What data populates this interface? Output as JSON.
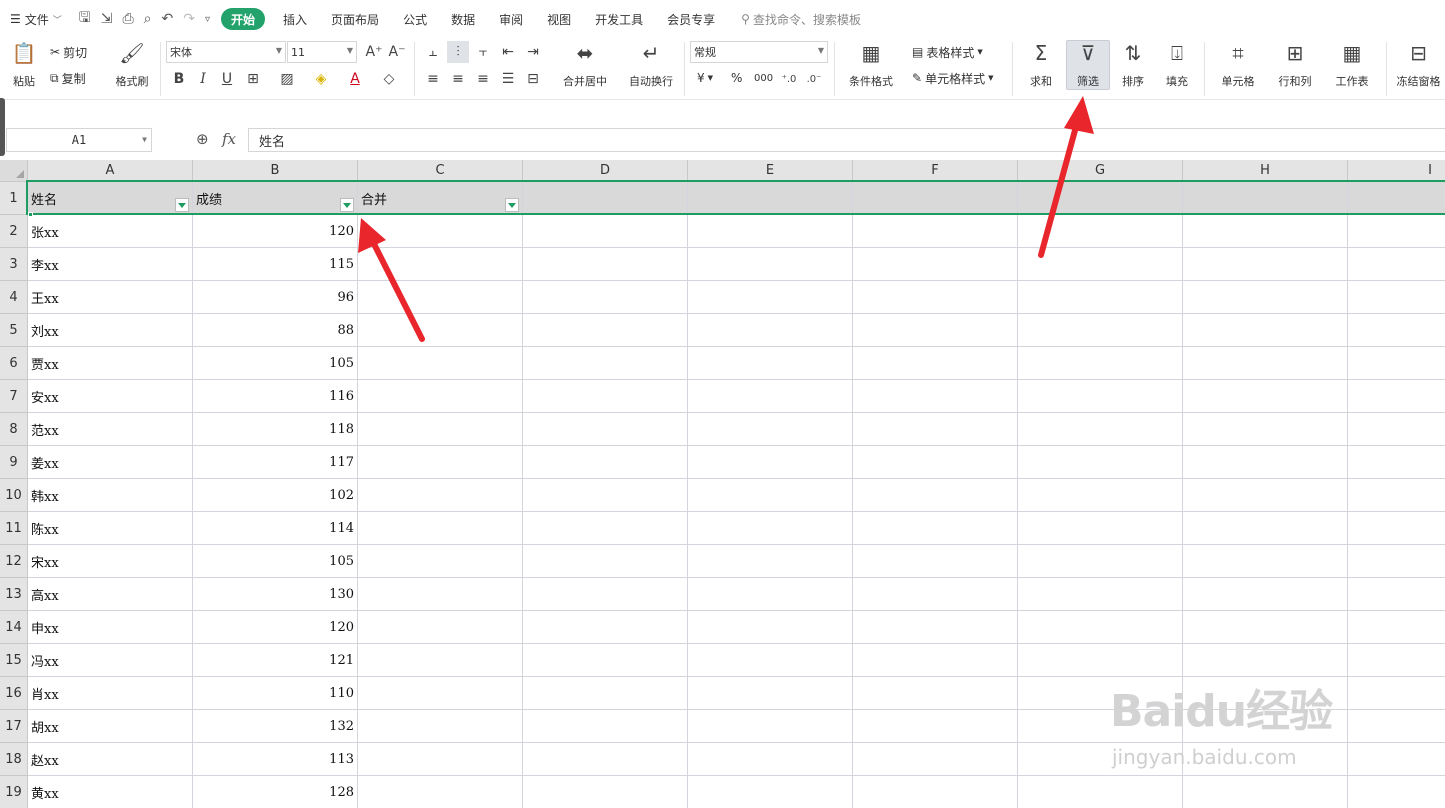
{
  "menubar": {
    "file": "文件",
    "tabs": [
      "开始",
      "插入",
      "页面布局",
      "公式",
      "数据",
      "审阅",
      "视图",
      "开发工具",
      "会员专享"
    ],
    "active_tab": "开始",
    "search": "查找命令、搜索模板"
  },
  "ribbon": {
    "paste": "粘贴",
    "cut": "剪切",
    "copy": "复制",
    "format_painter": "格式刷",
    "font_name": "宋体",
    "font_size": "11",
    "merge_center": "合并居中",
    "wrap_text": "自动换行",
    "number_format": "常规",
    "currency": "¥",
    "percent": "%",
    "thousands": "000",
    "conditional_format": "条件格式",
    "table_style": "表格样式",
    "cell_style": "单元格样式",
    "sum": "求和",
    "filter": "筛选",
    "sort": "排序",
    "fill": "填充",
    "cell": "单元格",
    "row_col": "行和列",
    "worksheet": "工作表",
    "freeze": "冻结窗格"
  },
  "formula_bar": {
    "cell_ref": "A1",
    "fx": "fx",
    "content": "姓名"
  },
  "sheet": {
    "columns": [
      "A",
      "B",
      "C",
      "D",
      "E",
      "F",
      "G",
      "H",
      "I"
    ],
    "header_row": [
      "姓名",
      "成绩",
      "合并"
    ],
    "rows": [
      [
        "张xx",
        "120"
      ],
      [
        "李xx",
        "115"
      ],
      [
        "王xx",
        "96"
      ],
      [
        "刘xx",
        "88"
      ],
      [
        "贾xx",
        "105"
      ],
      [
        "安xx",
        "116"
      ],
      [
        "范xx",
        "118"
      ],
      [
        "姜xx",
        "117"
      ],
      [
        "韩xx",
        "102"
      ],
      [
        "陈xx",
        "114"
      ],
      [
        "宋xx",
        "105"
      ],
      [
        "高xx",
        "130"
      ],
      [
        "申xx",
        "120"
      ],
      [
        "冯xx",
        "121"
      ],
      [
        "肖xx",
        "110"
      ],
      [
        "胡xx",
        "132"
      ],
      [
        "赵xx",
        "113"
      ],
      [
        "黄xx",
        "128"
      ]
    ]
  },
  "colors": {
    "accent": "#23a36b",
    "arrow": "#e8262b"
  },
  "watermark": {
    "logo": "Baidu经验",
    "url": "jingyan.baidu.com"
  }
}
